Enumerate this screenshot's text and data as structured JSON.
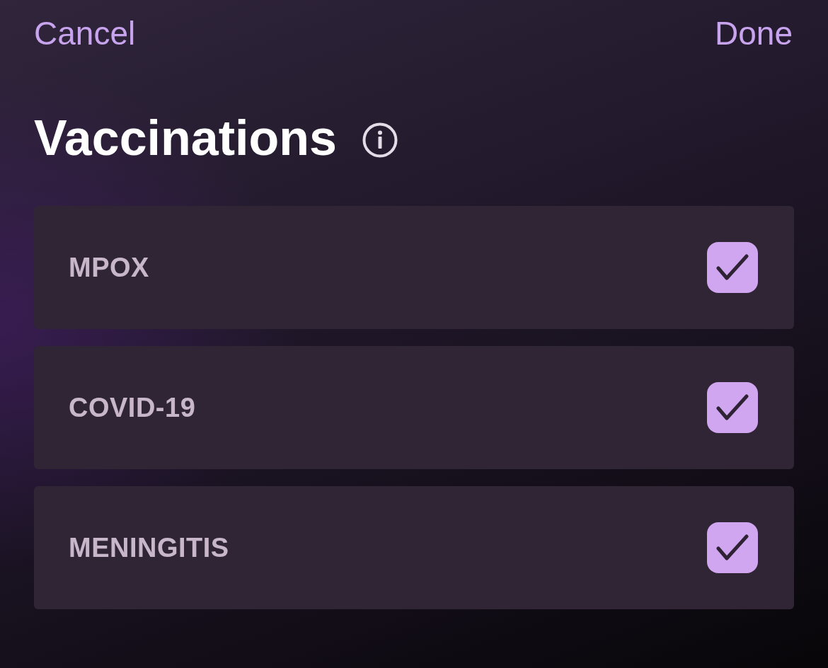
{
  "header": {
    "cancel": "Cancel",
    "done": "Done"
  },
  "title": "Vaccinations",
  "vaccines": [
    {
      "name": "MPOX",
      "checked": true
    },
    {
      "name": "COVID-19",
      "checked": true
    },
    {
      "name": "MENINGITIS",
      "checked": true
    }
  ]
}
